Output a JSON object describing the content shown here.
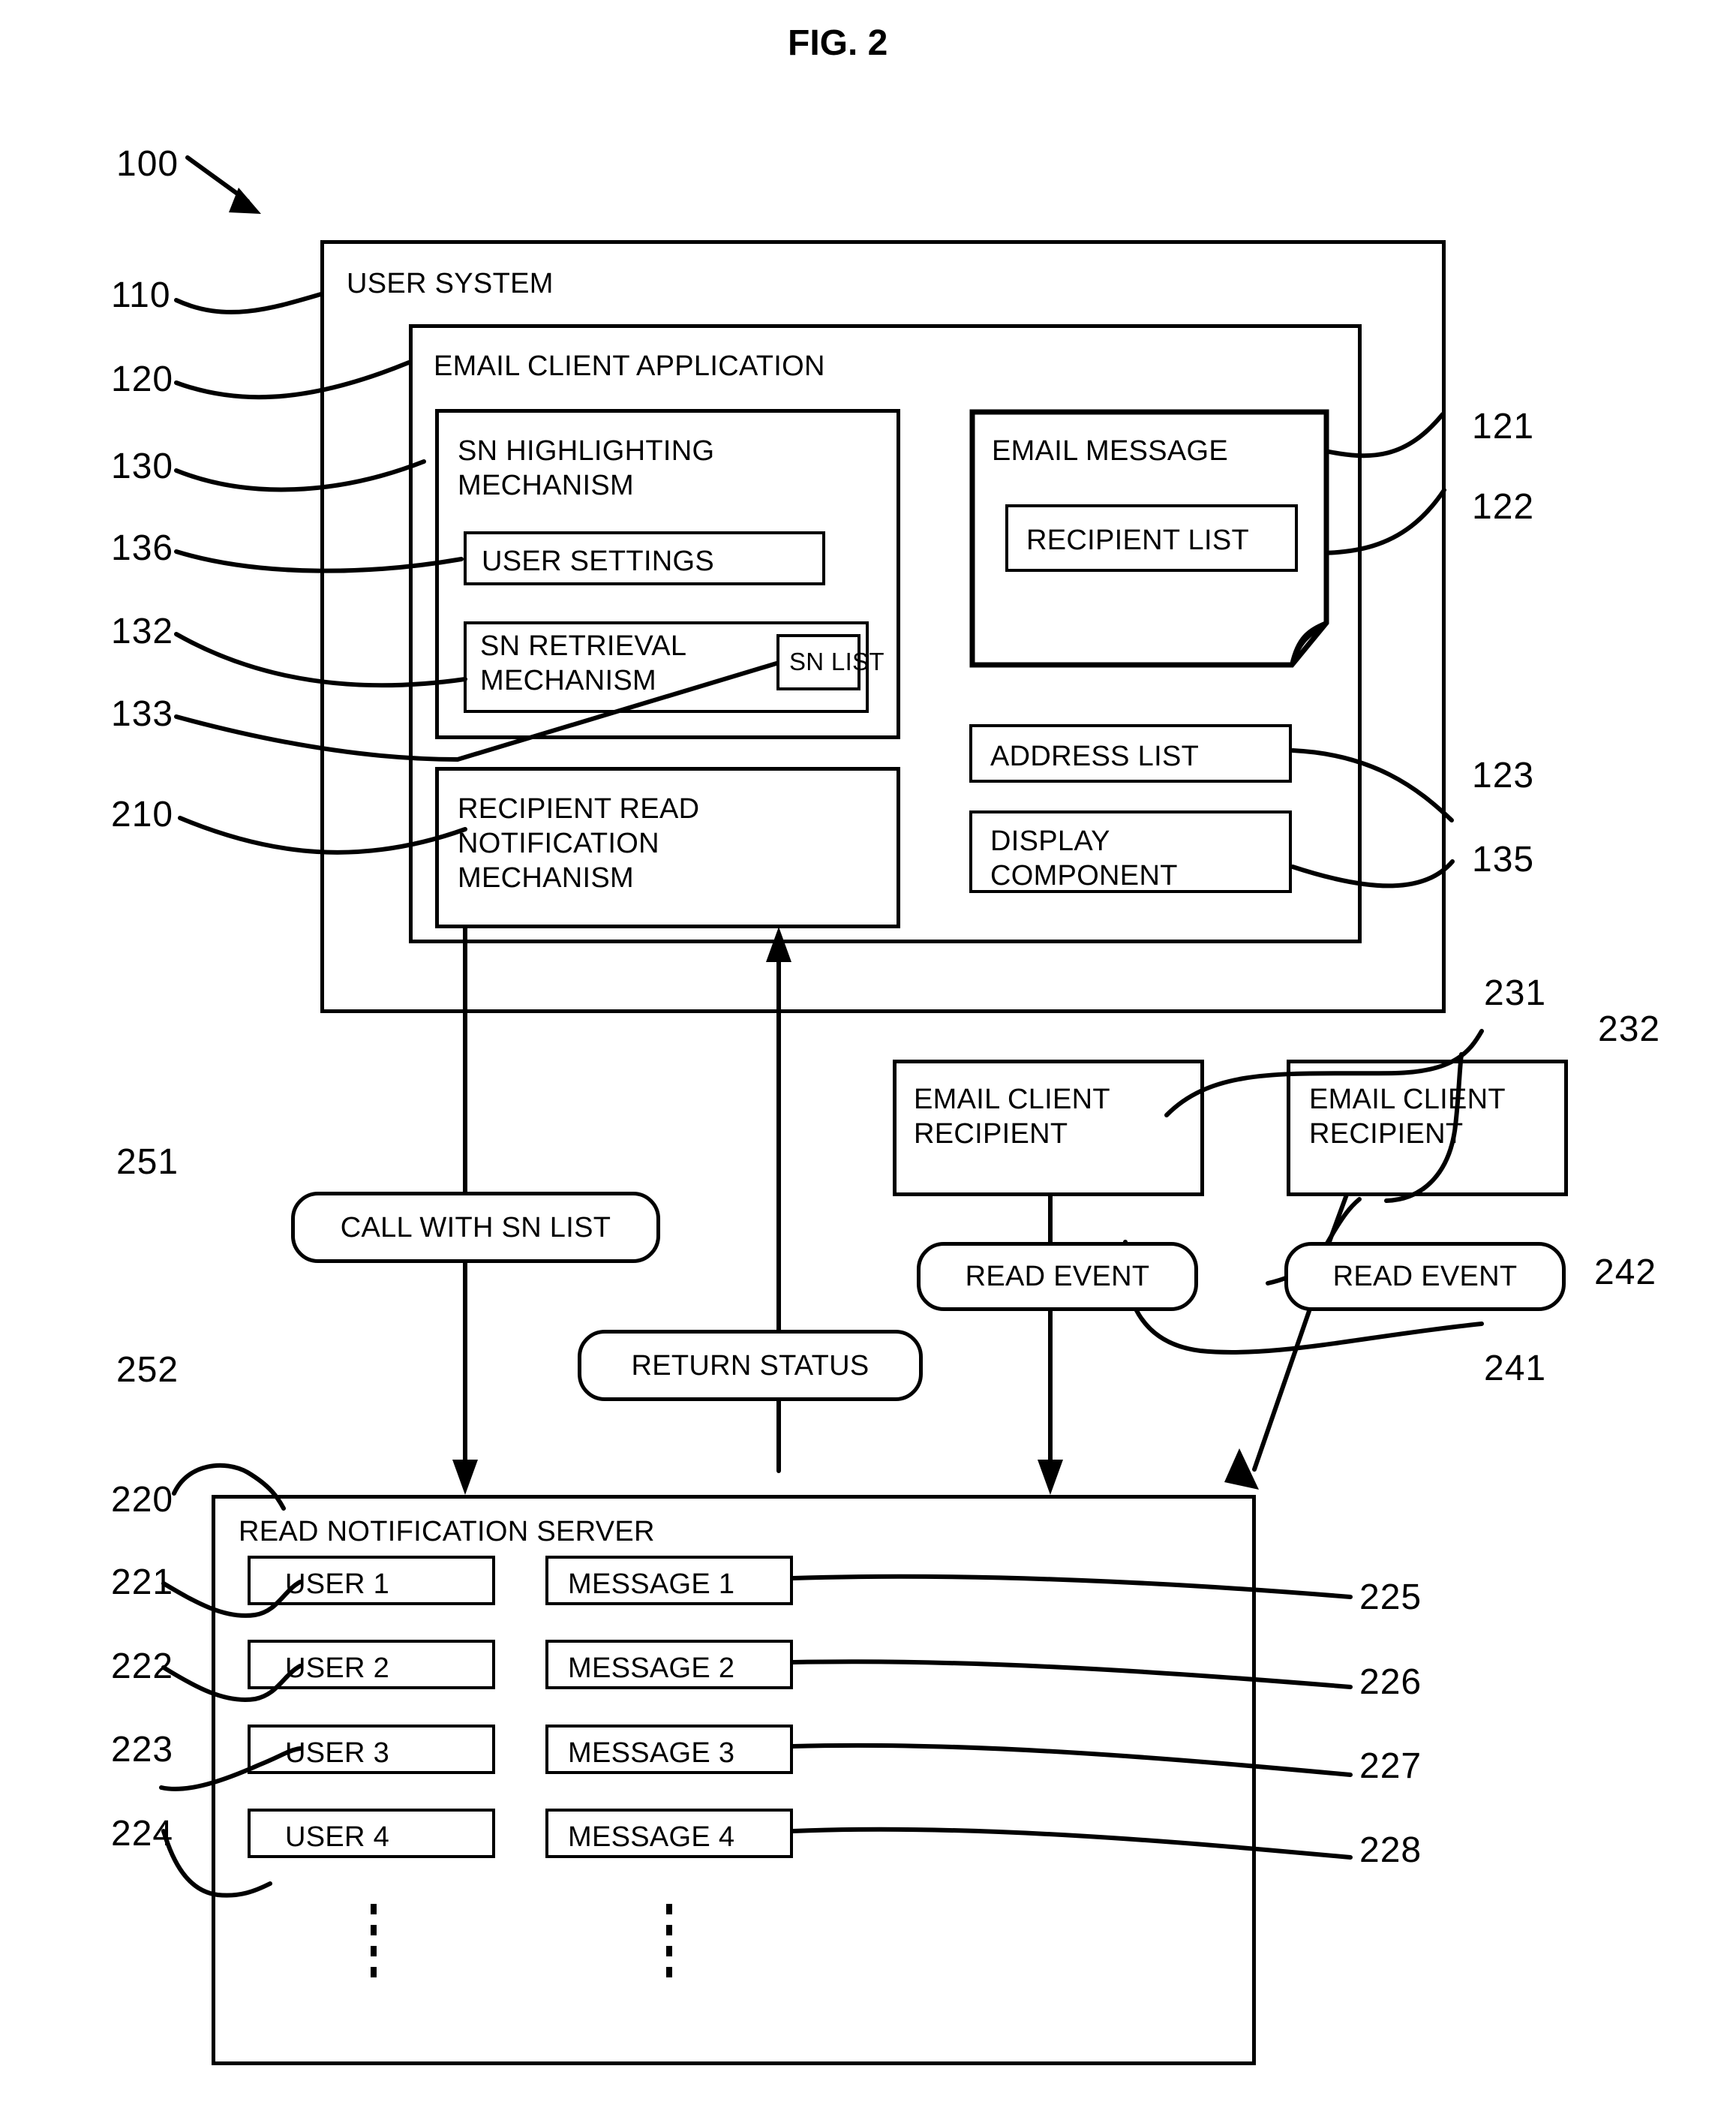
{
  "figure": {
    "title": "FIG. 2",
    "system_ref": "100"
  },
  "boxes": {
    "user_system": {
      "label": "USER SYSTEM",
      "ref": "110"
    },
    "email_client_application": {
      "label": "EMAIL CLIENT APPLICATION",
      "ref": "120"
    },
    "sn_highlighting_mechanism": {
      "label": "SN HIGHLIGHTING\nMECHANISM",
      "ref": "130"
    },
    "user_settings": {
      "label": "USER SETTINGS",
      "ref": "136"
    },
    "sn_retrieval_mechanism": {
      "label": "SN RETRIEVAL\nMECHANISM",
      "ref": "132"
    },
    "sn_list": {
      "label": "SN LIST",
      "ref": "133"
    },
    "recipient_read_notification_mechanism": {
      "label": "RECIPIENT READ\nNOTIFICATION\nMECHANISM",
      "ref": "210"
    },
    "email_message": {
      "label": "EMAIL MESSAGE",
      "ref": "121"
    },
    "recipient_list": {
      "label": "RECIPIENT LIST",
      "ref": "122"
    },
    "address_list": {
      "label": "ADDRESS LIST",
      "ref": "123"
    },
    "display_component": {
      "label": "DISPLAY\nCOMPONENT",
      "ref": "135"
    },
    "email_client_recipient_1": {
      "label": "EMAIL CLIENT\nRECIPIENT",
      "ref": "231"
    },
    "email_client_recipient_2": {
      "label": "EMAIL CLIENT\nRECIPIENT",
      "ref": "232"
    },
    "read_event_1": {
      "label": "READ EVENT",
      "ref": "241"
    },
    "read_event_2": {
      "label": "READ EVENT",
      "ref": "242"
    },
    "call_with_sn_list": {
      "label": "CALL WITH SN LIST",
      "ref": "251"
    },
    "return_status": {
      "label": "RETURN STATUS",
      "ref": "252"
    },
    "read_notification_server": {
      "label": "READ NOTIFICATION SERVER",
      "ref": "220"
    }
  },
  "server_records": {
    "users": [
      {
        "label": "USER 1",
        "ref": "221"
      },
      {
        "label": "USER 2",
        "ref": "222"
      },
      {
        "label": "USER 3",
        "ref": "223"
      },
      {
        "label": "USER 4",
        "ref": "224"
      }
    ],
    "messages": [
      {
        "label": "MESSAGE 1",
        "ref": "225"
      },
      {
        "label": "MESSAGE 2",
        "ref": "226"
      },
      {
        "label": "MESSAGE 3",
        "ref": "227"
      },
      {
        "label": "MESSAGE 4",
        "ref": "228"
      }
    ],
    "continuation_marker": "⋮"
  },
  "colors": {
    "line": "#000000",
    "background": "#ffffff"
  }
}
